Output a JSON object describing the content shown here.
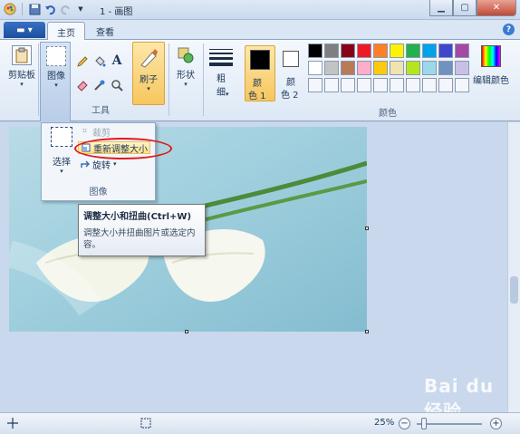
{
  "window": {
    "title": "1 - 画图"
  },
  "winbuttons": {
    "minimize": "▁",
    "maximize": "▢",
    "close": "✕"
  },
  "tabs": {
    "file": "▬ ▾",
    "home": "主页",
    "view": "查看"
  },
  "ribbon": {
    "clipboard_label": "剪贴板",
    "image_label": "图像",
    "tools_group": "工具",
    "brush_label": "刷子",
    "shapes_label": "形状",
    "size_label_1": "粗",
    "size_label_2": "细",
    "color1_label_1": "颜",
    "color1_label_2": "色 1",
    "color2_label_1": "颜",
    "color2_label_2": "色 2",
    "colors_group": "颜色",
    "edit_colors_label": "编辑颜色"
  },
  "palette_colors": [
    "#000000",
    "#7f7f7f",
    "#880015",
    "#ed1c24",
    "#ff7f27",
    "#fff200",
    "#22b14c",
    "#00a2e8",
    "#3f48cc",
    "#a349a4",
    "#ffffff",
    "#c3c3c3",
    "#b97a57",
    "#ffaec9",
    "#ffc90e",
    "#efe4b0",
    "#b5e61d",
    "#99d9ea",
    "#7092be",
    "#c8bfe7"
  ],
  "dropdown": {
    "select_label": "选择",
    "crop_label": "裁剪",
    "resize_label": "重新调整大小",
    "rotate_label": "旋转",
    "group_label": "图像"
  },
  "tooltip": {
    "title": "调整大小和扭曲(Ctrl+W)",
    "description": "调整大小并扭曲图片或选定内容。"
  },
  "status": {
    "zoom": "25%"
  },
  "watermark": "Bai du 经验"
}
